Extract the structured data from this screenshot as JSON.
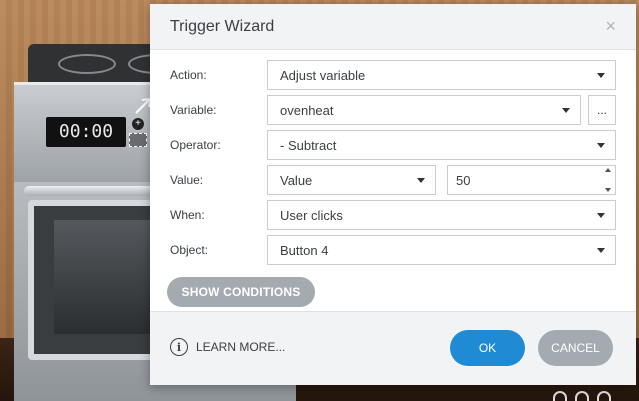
{
  "background": {
    "clock_display": "00:00",
    "plus_glyph": "+"
  },
  "dialog": {
    "title": "Trigger Wizard",
    "close_glyph": "×",
    "fields": {
      "action": {
        "label": "Action:",
        "value": "Adjust variable"
      },
      "variable": {
        "label": "Variable:",
        "value": "ovenheat",
        "browse_label": "..."
      },
      "operator": {
        "label": "Operator:",
        "value": "- Subtract"
      },
      "value": {
        "label": "Value:",
        "type_value": "Value",
        "number": "50"
      },
      "when": {
        "label": "When:",
        "value": "User clicks"
      },
      "object": {
        "label": "Object:",
        "value": "Button 4"
      }
    },
    "show_conditions_label": "SHOW CONDITIONS",
    "footer": {
      "info_glyph": "i",
      "learn_more_label": "LEARN MORE...",
      "ok_label": "OK",
      "cancel_label": "CANCEL"
    }
  }
}
